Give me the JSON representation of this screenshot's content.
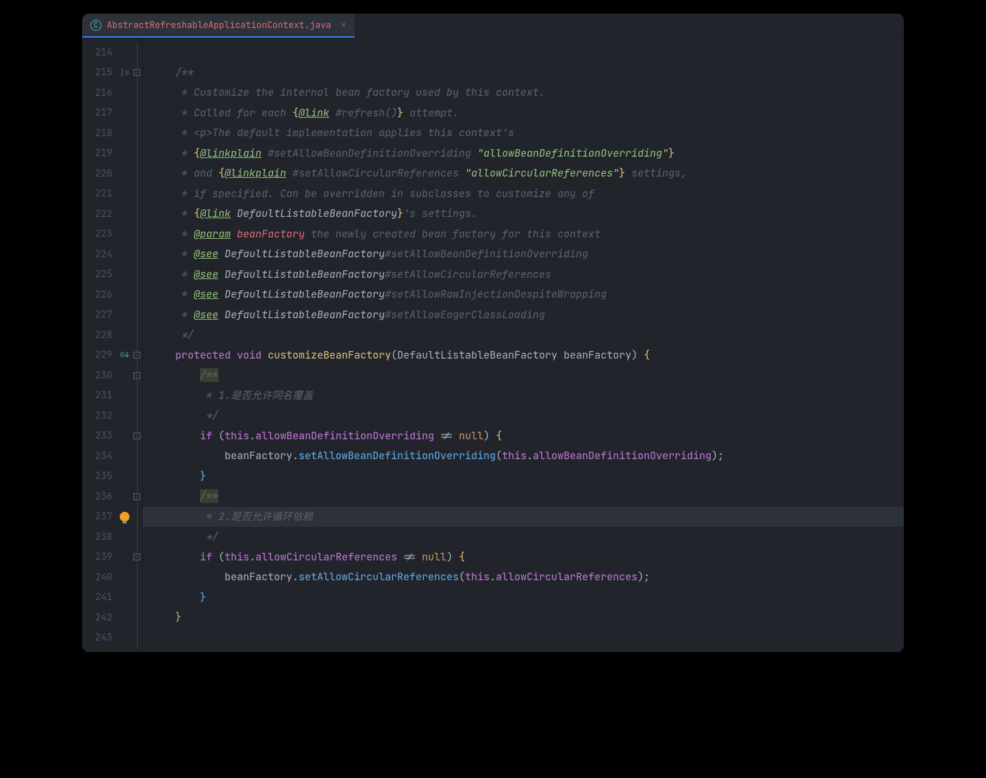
{
  "tab": {
    "filename": "AbstractRefreshableApplicationContext.java",
    "icon_label": "C"
  },
  "lines": {
    "start": 214,
    "end": 243
  },
  "code": {
    "l215": "    /**",
    "l216_pre": "     * ",
    "l216_txt": "Customize the internal bean factory used by this context.",
    "l217_pre": "     * ",
    "l217_a": "Called for each ",
    "l217_b": "{",
    "l217_tag": "@link",
    "l217_c": " #refresh()",
    "l217_d": "}",
    "l217_e": " attempt.",
    "l218_pre": "     * ",
    "l218_a": "<p>",
    "l218_txt": "The default implementation applies this context's",
    "l219_pre": "     * ",
    "l219_a": "{",
    "l219_tag": "@linkplain",
    "l219_b": " #setAllowBeanDefinitionOverriding ",
    "l219_str": "\"allowBeanDefinitionOverriding\"",
    "l219_c": "}",
    "l220_pre": "     * ",
    "l220_a": "and ",
    "l220_b": "{",
    "l220_tag": "@linkplain",
    "l220_c": " #setAllowCircularReferences ",
    "l220_str": "\"allowCircularReferences\"",
    "l220_d": "}",
    "l220_e": " settings,",
    "l221_pre": "     * ",
    "l221_txt": "if specified. Can be overridden in subclasses to customize any of",
    "l222_pre": "     * ",
    "l222_a": "{",
    "l222_tag": "@link",
    "l222_b": " DefaultListableBeanFactory",
    "l222_c": "}",
    "l222_d": "'s settings.",
    "l223_pre": "     * ",
    "l223_tag": "@param",
    "l223_param": " beanFactory",
    "l223_txt": " the newly created bean factory for this context",
    "l224_pre": "     * ",
    "l224_tag": "@see",
    "l224_a": " DefaultListableBeanFactory",
    "l224_b": "#setAllowBeanDefinitionOverriding",
    "l225_pre": "     * ",
    "l225_tag": "@see",
    "l225_a": " DefaultListableBeanFactory",
    "l225_b": "#setAllowCircularReferences",
    "l226_pre": "     * ",
    "l226_tag": "@see",
    "l226_a": " DefaultListableBeanFactory",
    "l226_b": "#setAllowRawInjectionDespiteWrapping",
    "l227_pre": "     * ",
    "l227_tag": "@see",
    "l227_a": " DefaultListableBeanFactory",
    "l227_b": "#setAllowEagerClassLoading",
    "l228": "     */",
    "l229_ind": "    ",
    "l229_protected": "protected",
    "l229_sp1": " ",
    "l229_void": "void",
    "l229_sp2": " ",
    "l229_method": "customizeBeanFactory",
    "l229_po": "(",
    "l229_type": "DefaultListableBeanFactory",
    "l229_sp3": " ",
    "l229_param": "beanFactory",
    "l229_pc": ") ",
    "l229_brace": "{",
    "l230": "        /**",
    "l231_pre": "         * ",
    "l231_txt": "1.是否允许同名覆盖",
    "l232": "         */",
    "l233_ind": "        ",
    "l233_if": "if",
    "l233_po": " (",
    "l233_this": "this",
    "l233_dot": ".",
    "l233_field": "allowBeanDefinitionOverriding",
    "l233_ne": " != ",
    "l233_null": "null",
    "l233_pc": ") ",
    "l233_brace": "{",
    "l234_ind": "            ",
    "l234_obj": "beanFactory",
    "l234_dot": ".",
    "l234_method": "setAllowBeanDefinitionOverriding",
    "l234_po": "(",
    "l234_this": "this",
    "l234_dot2": ".",
    "l234_field": "allowBeanDefinitionOverriding",
    "l234_pc": ");",
    "l235_ind": "        ",
    "l235_brace": "}",
    "l236": "        /**",
    "l237_pre": "         * ",
    "l237_txt": "2.是否允许循环依赖",
    "l238": "         */",
    "l239_ind": "        ",
    "l239_if": "if",
    "l239_po": " (",
    "l239_this": "this",
    "l239_dot": ".",
    "l239_field": "allowCircularReferences",
    "l239_ne": " != ",
    "l239_null": "null",
    "l239_pc": ") ",
    "l239_brace": "{",
    "l240_ind": "            ",
    "l240_obj": "beanFactory",
    "l240_dot": ".",
    "l240_method": "setAllowCircularReferences",
    "l240_po": "(",
    "l240_this": "this",
    "l240_dot2": ".",
    "l240_field": "allowCircularReferences",
    "l240_pc": ");",
    "l241_ind": "        ",
    "l241_brace": "}",
    "l242_ind": "    ",
    "l242_brace": "}"
  }
}
